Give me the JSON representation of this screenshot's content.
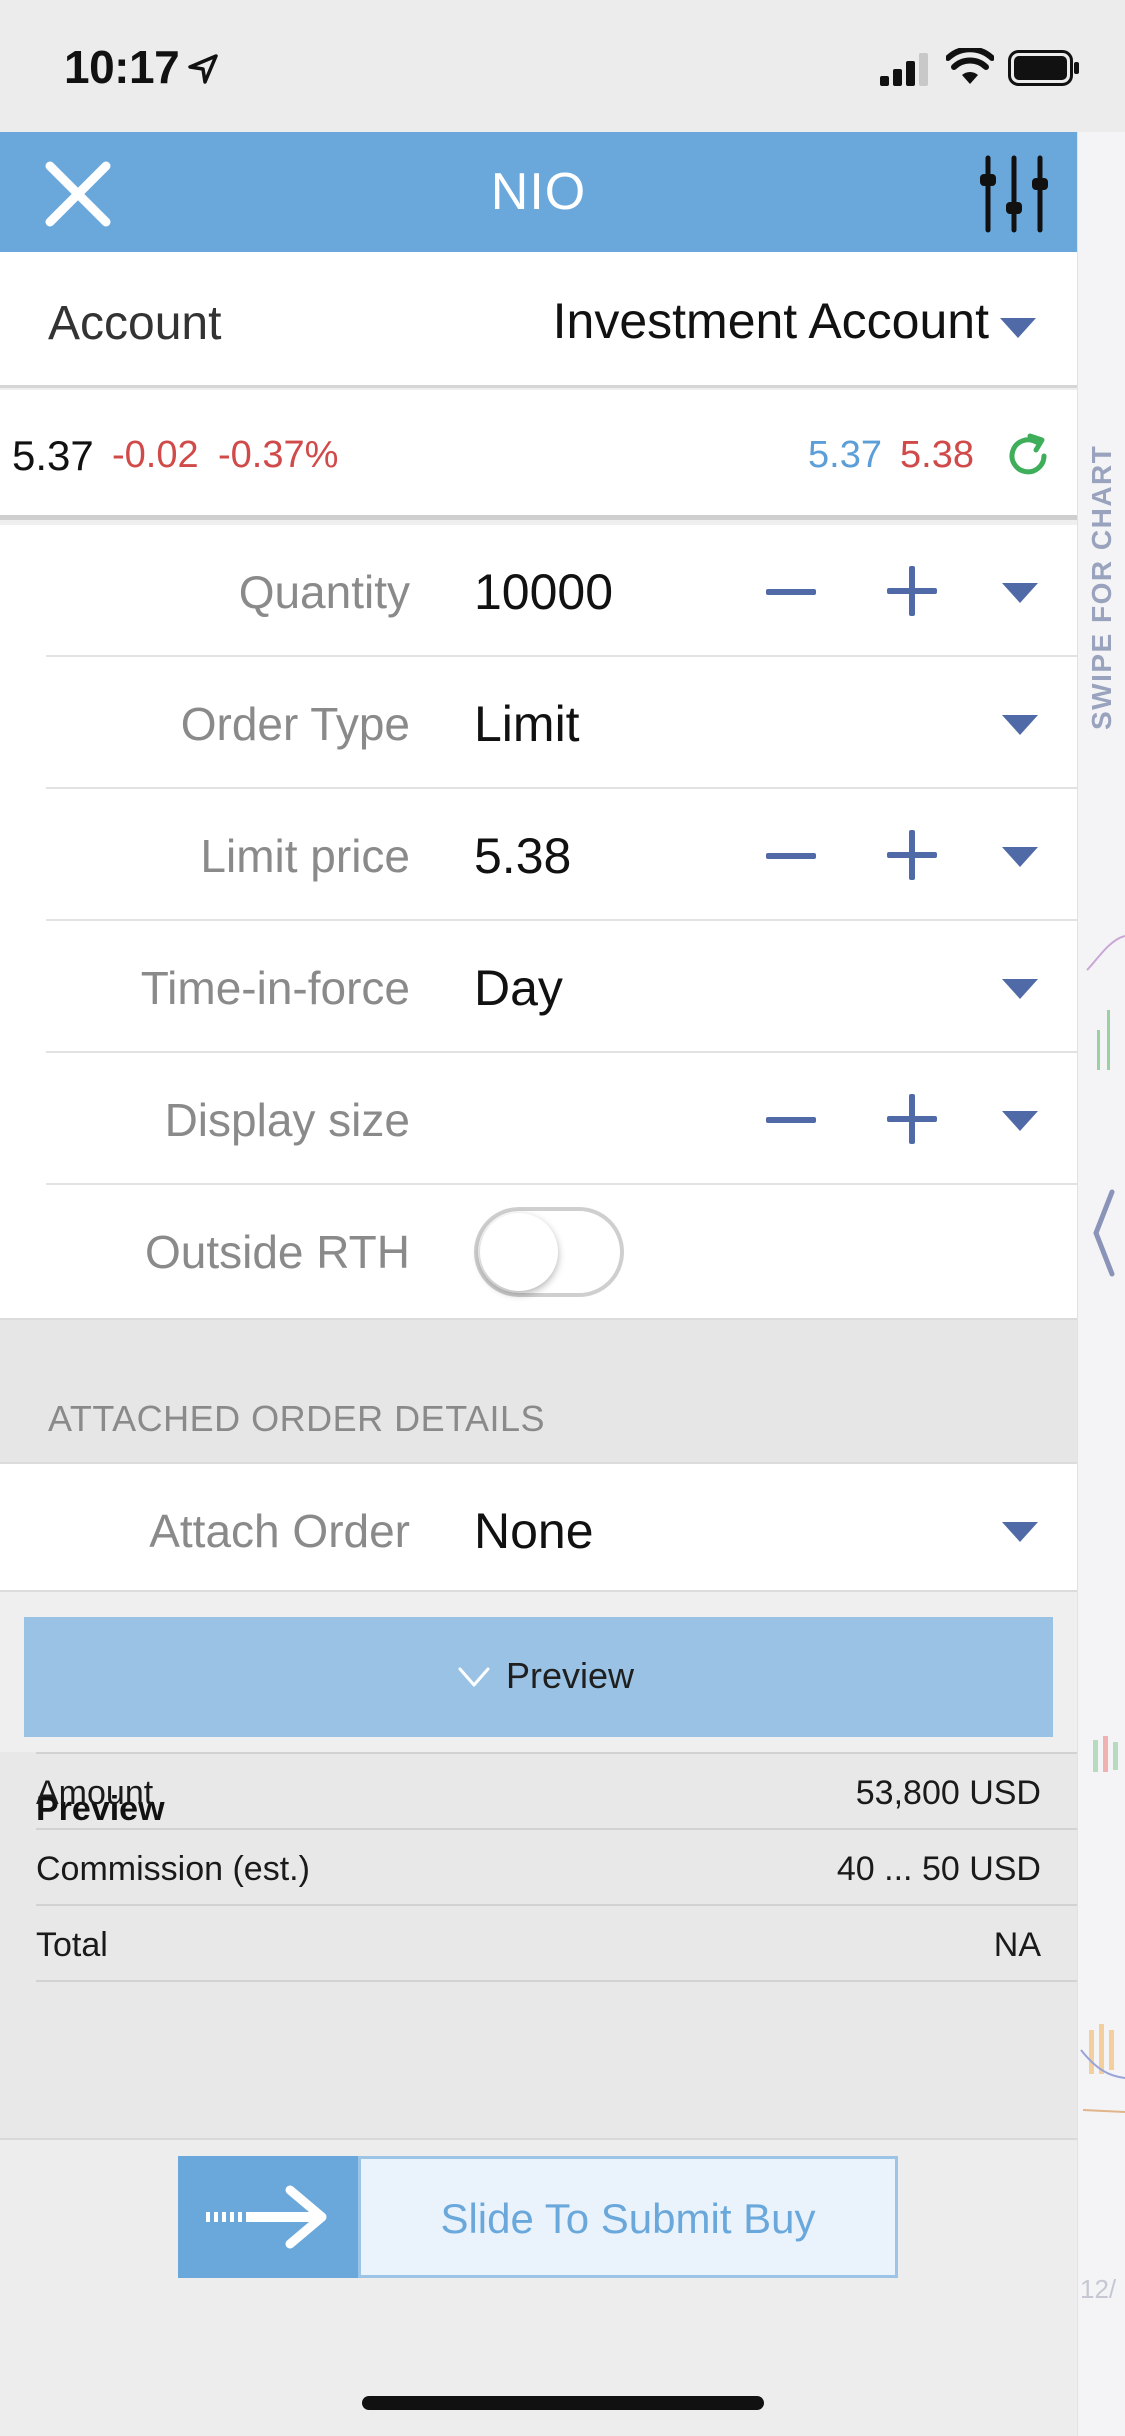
{
  "status_bar": {
    "time": "10:17",
    "icons": [
      "location-arrow-icon",
      "cellular-signal-icon",
      "wifi-icon",
      "battery-icon"
    ]
  },
  "header": {
    "title": "NIO",
    "left_icon": "close-icon",
    "right_icon": "sliders-icon",
    "color": "#6aa8dc"
  },
  "account": {
    "label": "Account",
    "value": "Investment Account"
  },
  "quote": {
    "last": "5.37",
    "change": "-0.02",
    "change_pct": "-0.37%",
    "bid": "5.37",
    "ask": "5.38",
    "up_color": "#5c9fd8",
    "down_color": "#d04a4a"
  },
  "form": {
    "quantity": {
      "label": "Quantity",
      "value": "10000"
    },
    "order_type": {
      "label": "Order Type",
      "value": "Limit"
    },
    "limit_price": {
      "label": "Limit price",
      "value": "5.38"
    },
    "time_in_force": {
      "label": "Time-in-force",
      "value": "Day"
    },
    "display_size": {
      "label": "Display size",
      "value": ""
    },
    "outside_rth": {
      "label": "Outside RTH",
      "enabled": false
    }
  },
  "attached": {
    "section_title": "ATTACHED ORDER DETAILS",
    "attach_order": {
      "label": "Attach Order",
      "value": "None"
    }
  },
  "preview": {
    "button_label": "Preview",
    "title": "Preview",
    "rows": [
      {
        "key": "Amount",
        "value": "53,800 USD"
      },
      {
        "key": "Commission (est.)",
        "value": "40 ... 50 USD"
      },
      {
        "key": "Total",
        "value": "NA"
      }
    ]
  },
  "submit": {
    "label": "Slide To Submit Buy"
  },
  "side_panel": {
    "label": "SWIPE FOR CHART",
    "date_fragment": "12/"
  }
}
